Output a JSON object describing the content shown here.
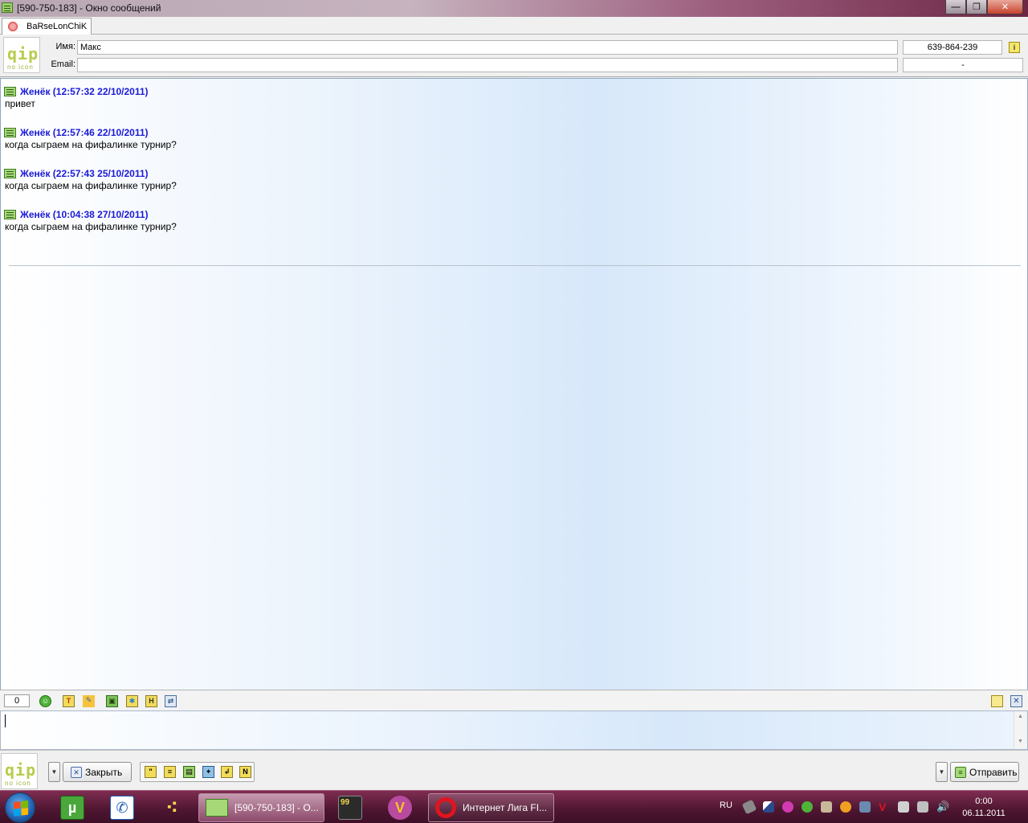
{
  "window": {
    "title": "[590-750-183] - Окно сообщений"
  },
  "tabs": [
    {
      "label": "BaRseLonChiK"
    }
  ],
  "contact": {
    "avatar_text": "qip",
    "avatar_sub": "no icon",
    "name_label": "Имя:",
    "name_value": "Макс",
    "email_label": "Email:",
    "email_value": "",
    "uin": "639-864-239",
    "extra": "-"
  },
  "messages": [
    {
      "header": "Женёк (12:57:32 22/10/2011)",
      "text": "привет"
    },
    {
      "header": "Женёк (12:57:46 22/10/2011)",
      "text": "когда сыграем на фифалинке турнир?"
    },
    {
      "header": "Женёк (22:57:43 25/10/2011)",
      "text": "когда сыграем на фифалинке турнир?"
    },
    {
      "header": "Женёк (10:04:38 27/10/2011)",
      "text": "когда сыграем на фифалинке турнир?"
    }
  ],
  "input": {
    "char_count": "0",
    "text": ""
  },
  "toolbar_icons": [
    "smiley-icon",
    "text-format-icon",
    "color-icon",
    "save-icon",
    "snowflake-icon",
    "history-icon",
    "translit-icon"
  ],
  "buttons": {
    "close_label": "Закрыть",
    "send_label": "Отправить"
  },
  "taskbar": {
    "window1_label": "[590-750-183] - О...",
    "window2_label": "Интернет Лига FI...",
    "lang": "RU",
    "time": "0:00",
    "date": "06.11.2011",
    "app_99_label": "99"
  },
  "colors": {
    "sender": "#1a1ad8",
    "accent": "#a6d877"
  }
}
